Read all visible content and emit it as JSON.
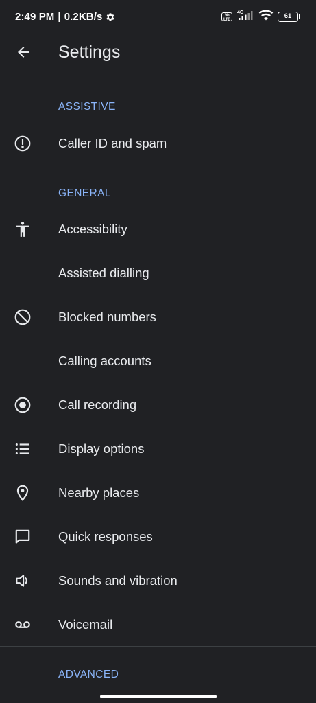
{
  "status_bar": {
    "time": "2:49 PM",
    "separator": "|",
    "net_speed": "0.2KB/s",
    "volte_label": "Vo LTE",
    "network_type": "4G",
    "battery_level": "61"
  },
  "app_bar": {
    "title": "Settings",
    "back_icon": "arrow-back-icon"
  },
  "sections": {
    "assistive": {
      "header": "ASSISTIVE",
      "items": {
        "caller_id": {
          "label": "Caller ID and spam",
          "icon": "alert-circle-icon"
        }
      }
    },
    "general": {
      "header": "GENERAL",
      "items": {
        "accessibility": {
          "label": "Accessibility",
          "icon": "accessibility-icon"
        },
        "assisted_dialling": {
          "label": "Assisted dialling",
          "icon": ""
        },
        "blocked_numbers": {
          "label": "Blocked numbers",
          "icon": "block-icon"
        },
        "calling_accounts": {
          "label": "Calling accounts",
          "icon": ""
        },
        "call_recording": {
          "label": "Call recording",
          "icon": "record-icon"
        },
        "display_options": {
          "label": "Display options",
          "icon": "list-icon"
        },
        "nearby_places": {
          "label": "Nearby places",
          "icon": "location-pin-icon"
        },
        "quick_responses": {
          "label": "Quick responses",
          "icon": "message-icon"
        },
        "sounds_vibration": {
          "label": "Sounds and vibration",
          "icon": "volume-icon"
        },
        "voicemail": {
          "label": "Voicemail",
          "icon": "voicemail-icon"
        }
      }
    },
    "advanced": {
      "header": "ADVANCED"
    }
  },
  "colors": {
    "background": "#202124",
    "text": "#e8eaed",
    "accent": "#8ab4f8",
    "divider": "#3c4043"
  }
}
